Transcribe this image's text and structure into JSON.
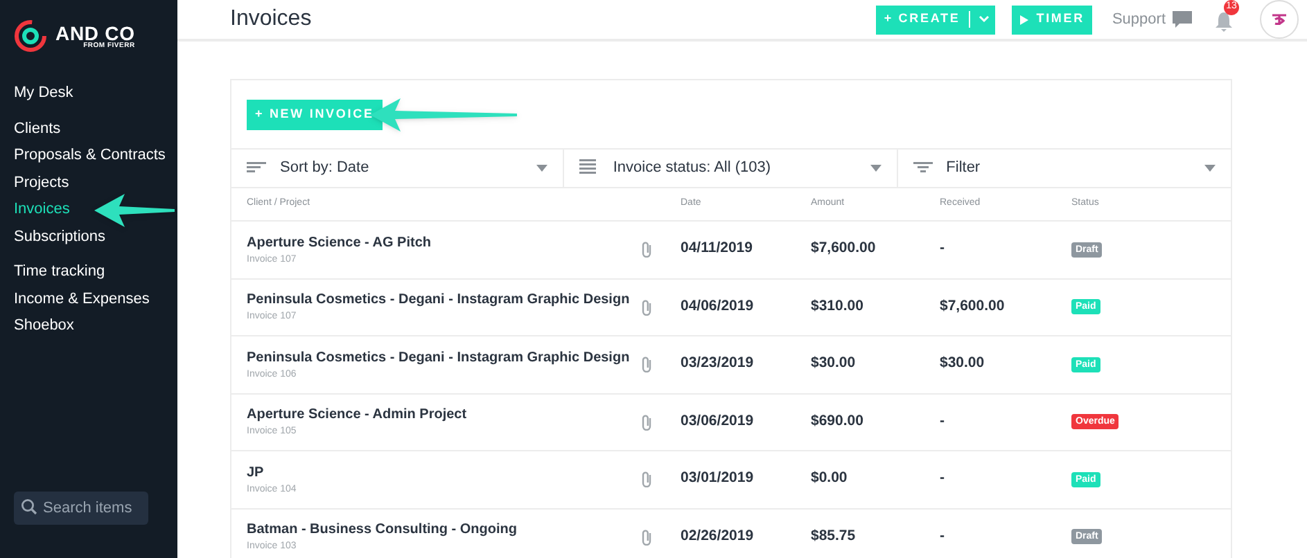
{
  "logo": {
    "name": "AND CO",
    "tagline": "FROM FIVERR"
  },
  "sidebar": {
    "sections": [
      {
        "items": [
          {
            "label": "My Desk",
            "selected": false
          }
        ]
      },
      {
        "items": [
          {
            "label": "Clients",
            "selected": false
          },
          {
            "label": "Proposals & Contracts",
            "selected": false
          },
          {
            "label": "Projects",
            "selected": false
          },
          {
            "label": "Invoices",
            "selected": true
          },
          {
            "label": "Subscriptions",
            "selected": false
          }
        ]
      },
      {
        "items": [
          {
            "label": "Time tracking",
            "selected": false
          },
          {
            "label": "Income & Expenses",
            "selected": false
          },
          {
            "label": "Shoebox",
            "selected": false
          }
        ]
      }
    ],
    "search": {
      "placeholder": "Search items"
    }
  },
  "header": {
    "title": "Invoices",
    "create": "+ CREATE",
    "timer": "TIMER",
    "support": "Support",
    "notifications": "13"
  },
  "new_invoice": "+ NEW INVOICE",
  "filters": [
    {
      "label": "Sort by: Date",
      "kind": "sort"
    },
    {
      "label": "Invoice status: All (103)",
      "kind": "list"
    },
    {
      "label": "Filter",
      "kind": "filter"
    }
  ],
  "table": {
    "columns": [
      "Client / Project",
      "Date",
      "Amount",
      "Received",
      "Status"
    ],
    "rows": [
      {
        "client": "Aperture Science - AG Pitch",
        "invoice": "Invoice 107",
        "date": "04/11/2019",
        "amount": "$7,600.00",
        "received": "-",
        "status": "Draft",
        "kind": "draft"
      },
      {
        "client": "Peninsula Cosmetics - Degani - Instagram Graphic Design",
        "invoice": "Invoice 107",
        "date": "04/06/2019",
        "amount": "$310.00",
        "received": "$7,600.00",
        "status": "Paid",
        "kind": "paid"
      },
      {
        "client": "Peninsula Cosmetics - Degani - Instagram Graphic Design",
        "invoice": "Invoice 106",
        "date": "03/23/2019",
        "amount": "$30.00",
        "received": "$30.00",
        "status": "Paid",
        "kind": "paid"
      },
      {
        "client": "Aperture Science - Admin Project",
        "invoice": "Invoice 105",
        "date": "03/06/2019",
        "amount": "$690.00",
        "received": "-",
        "status": "Overdue",
        "kind": "overdue"
      },
      {
        "client": "JP",
        "invoice": "Invoice 104",
        "date": "03/01/2019",
        "amount": "$0.00",
        "received": "-",
        "status": "Paid",
        "kind": "paid"
      },
      {
        "client": "Batman - Business Consulting - Ongoing",
        "invoice": "Invoice 103",
        "date": "02/26/2019",
        "amount": "$85.75",
        "received": "-",
        "status": "Draft",
        "kind": "draft"
      }
    ]
  }
}
